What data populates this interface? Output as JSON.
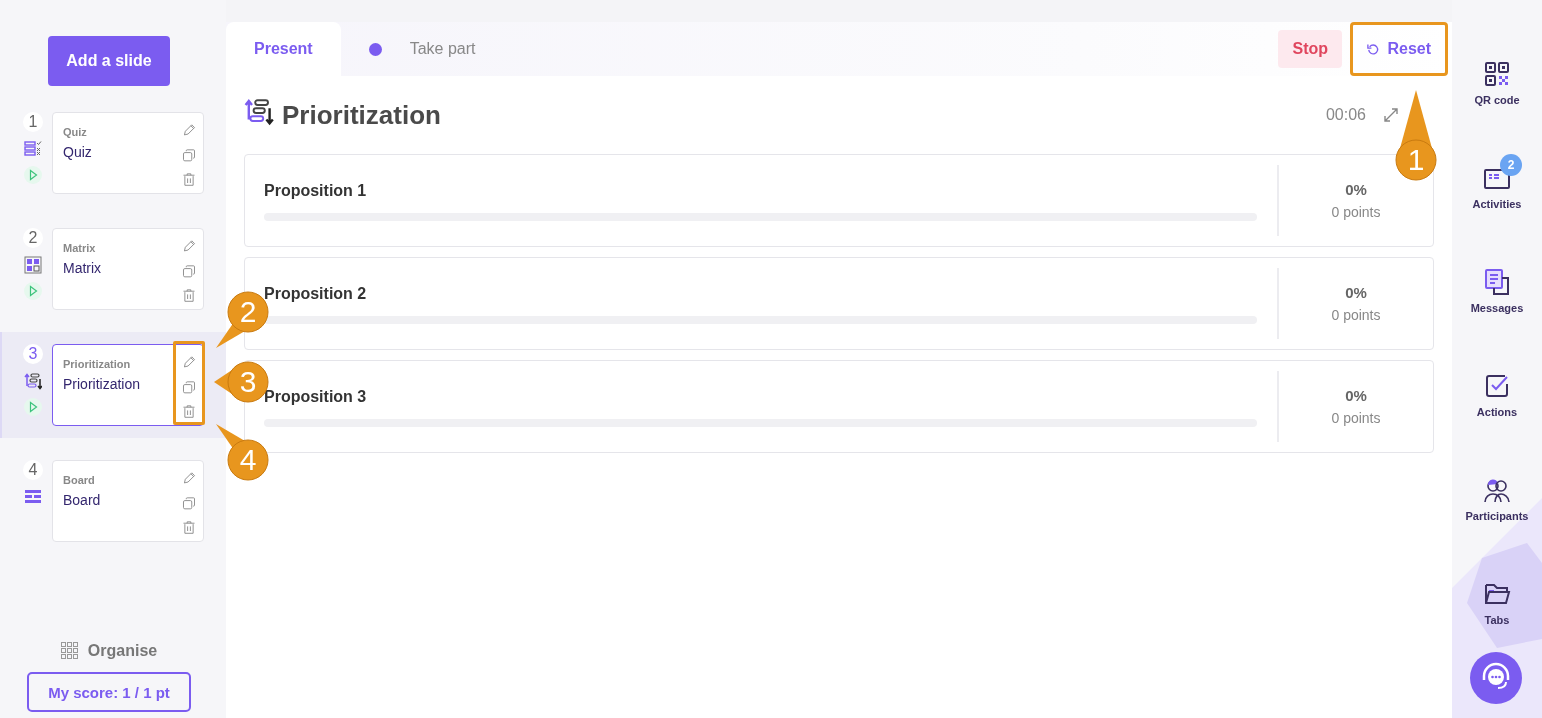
{
  "sidebar": {
    "add_button": "Add a slide",
    "slides": [
      {
        "number": "1",
        "kind": "quiz",
        "type_label": "Quiz",
        "title": "Quiz",
        "playable": true,
        "selected": false,
        "actions_highlighted": false
      },
      {
        "number": "2",
        "kind": "matrix",
        "type_label": "Matrix",
        "title": "Matrix",
        "playable": true,
        "selected": false,
        "actions_highlighted": false
      },
      {
        "number": "3",
        "kind": "prioritization",
        "type_label": "Prioritization",
        "title": "Prioritization",
        "playable": true,
        "selected": true,
        "actions_highlighted": true
      },
      {
        "number": "4",
        "kind": "board",
        "type_label": "Board",
        "title": "Board",
        "playable": false,
        "selected": false,
        "actions_highlighted": false
      }
    ],
    "organise": "Organise",
    "score": "My score: 1 / 1 pt"
  },
  "tabs": [
    {
      "label": "Present",
      "selected": true,
      "live": false
    },
    {
      "label": "Take part",
      "selected": false,
      "live": true
    }
  ],
  "buttons": [
    {
      "kind": "stop",
      "label": "Stop",
      "highlighted": false
    },
    {
      "kind": "reset",
      "label": "Reset",
      "highlighted": true
    }
  ],
  "activity": {
    "kind": "prioritization",
    "title": "Prioritization",
    "timer": "00:06"
  },
  "propositions": [
    {
      "label": "Proposition 1",
      "level": 0,
      "percent": "0%",
      "points": "0 points"
    },
    {
      "label": "Proposition 2",
      "level": 0,
      "percent": "0%",
      "points": "0 points"
    },
    {
      "label": "Proposition 3",
      "level": 0,
      "percent": "0%",
      "points": "0 points"
    }
  ],
  "rail": [
    {
      "kind": "qr",
      "label": "QR code"
    },
    {
      "kind": "activities",
      "label": "Activities",
      "badge": "2"
    },
    {
      "kind": "messages",
      "label": "Messages"
    },
    {
      "kind": "actions",
      "label": "Actions"
    },
    {
      "kind": "participants",
      "label": "Participants"
    },
    {
      "kind": "tabs",
      "label": "Tabs"
    }
  ],
  "annotations": [
    {
      "number": "1",
      "kind": "reset"
    },
    {
      "number": "2",
      "kind": "edit"
    },
    {
      "number": "3",
      "kind": "copy"
    },
    {
      "number": "4",
      "kind": "delete"
    }
  ]
}
